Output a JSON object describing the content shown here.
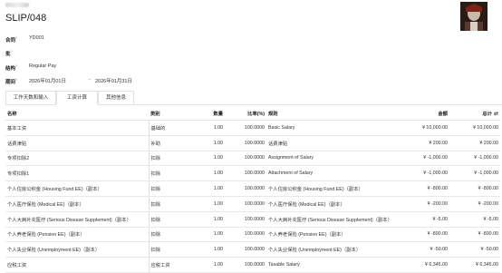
{
  "header": {
    "title": "SLIP/048"
  },
  "fields": {
    "contract_label": "合同",
    "contract_value": "YD001",
    "batch_label": "批",
    "structure_label": "结构",
    "structure_value": "Regular Pay",
    "period_label": "期间",
    "period_start": "2026年01月01日",
    "period_sep": "-",
    "period_end": "2026年01月31日",
    "help_mark": "?"
  },
  "tabs": [
    {
      "label": "工作天数和输入"
    },
    {
      "label": "工资计算"
    },
    {
      "label": "其他信息"
    }
  ],
  "table": {
    "headers": {
      "name": "名称",
      "category": "类别",
      "quantity": "数量",
      "rate": "比率(%)",
      "rule": "规则",
      "amount": "金额",
      "total": "总计"
    },
    "rows": [
      {
        "name": "基本工资",
        "category": "基础的",
        "quantity": "1.00",
        "rate": "100.0000",
        "rule": "Basic Salary",
        "amount": "¥ 10,000.00",
        "total": "¥ 10,000.00"
      },
      {
        "name": "话费津贴",
        "category": "补助",
        "quantity": "1.00",
        "rate": "100.0000",
        "rule": "话费津贴",
        "amount": "¥ 200.00",
        "total": "¥ 200.00"
      },
      {
        "name": "专项扣除2",
        "category": "扣除",
        "quantity": "1.00",
        "rate": "100.0000",
        "rule": "Assignment of Salary",
        "amount": "¥ -1,000.00",
        "total": "¥ -1,000.00"
      },
      {
        "name": "专项扣除1",
        "category": "扣除",
        "quantity": "1.00",
        "rate": "100.0000",
        "rule": "Attachment of Salary",
        "amount": "¥ -1,000.00",
        "total": "¥ -1,000.00"
      },
      {
        "name": "个人住房公积金 (Housing Fund EE)（副本）",
        "category": "扣除",
        "quantity": "1.00",
        "rate": "100.0000",
        "rule": "个人住房公积金 (Housing Fund EE)（副本）",
        "amount": "¥ -800.00",
        "total": "¥ -800.00"
      },
      {
        "name": "个人医疗保险 (Medical EE)（副本）",
        "category": "扣除",
        "quantity": "1.00",
        "rate": "100.0000",
        "rule": "个人医疗保险 (Medical EE)（副本）",
        "amount": "¥ -200.00",
        "total": "¥ -200.00"
      },
      {
        "name": "个人大病补充医疗 (Serious Disease Supplement)（副本）",
        "category": "扣除",
        "quantity": "1.00",
        "rate": "100.0000",
        "rule": "个人大病补充医疗 (Serious Disease Supplement)（副本）",
        "amount": "¥ -5.00",
        "total": "¥ -5.00"
      },
      {
        "name": "个人养老保险 (Pension EE)（副本）",
        "category": "扣除",
        "quantity": "1.00",
        "rate": "100.0000",
        "rule": "个人养老保险 (Pension EE)（副本）",
        "amount": "¥ -800.00",
        "total": "¥ -800.00"
      },
      {
        "name": "个人失业保险 (Unemployment EE)（副本）",
        "category": "扣除",
        "quantity": "1.00",
        "rate": "100.0000",
        "rule": "个人失业保险 (Unemployment EE)（副本）",
        "amount": "¥ -50.00",
        "total": "¥ -50.00"
      },
      {
        "name": "应税工资",
        "category": "应税工资",
        "quantity": "1.00",
        "rate": "100.0000",
        "rule": "Taxable Salary",
        "amount": "¥ 6,345.00",
        "total": "¥ 6,345.00"
      }
    ]
  },
  "icons": {
    "column_toggle": "sliders-icon",
    "avatar": "employee-avatar"
  }
}
